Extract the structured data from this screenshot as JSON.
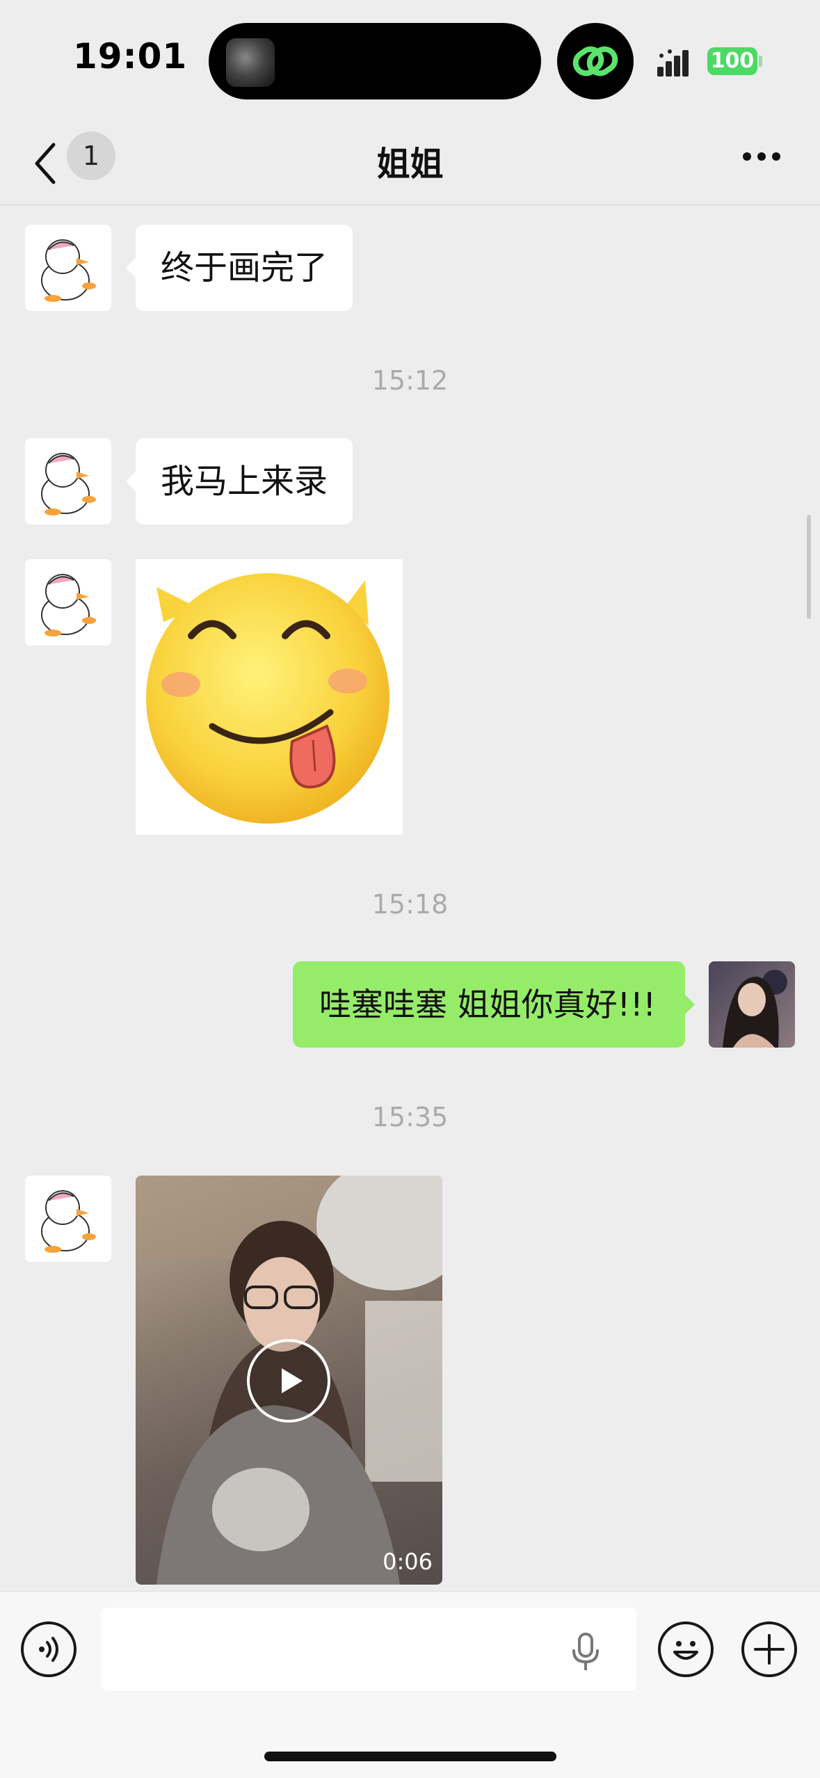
{
  "status_bar": {
    "time": "19:01",
    "battery": "100",
    "icons": [
      "album-art-icon",
      "link-icon",
      "signal-icon",
      "battery-icon"
    ]
  },
  "nav": {
    "back_icon": "chevron-left-icon",
    "unread_count": "1",
    "title": "姐姐",
    "more_icon": "ellipsis-icon"
  },
  "messages": [
    {
      "type": "text",
      "direction": "in",
      "text": "终于画完了"
    },
    {
      "type": "timestamp",
      "text": "15:12"
    },
    {
      "type": "text",
      "direction": "in",
      "text": "我马上来录"
    },
    {
      "type": "sticker",
      "direction": "in",
      "description": "smiley-tongue-sticker"
    },
    {
      "type": "timestamp",
      "text": "15:18"
    },
    {
      "type": "text",
      "direction": "out",
      "text": "哇塞哇塞 姐姐你真好!!!"
    },
    {
      "type": "timestamp",
      "text": "15:35"
    },
    {
      "type": "video",
      "direction": "in",
      "duration": "0:06"
    }
  ],
  "bottom_bar": {
    "voice_icon": "voice-icon",
    "input_placeholder": "",
    "mic_icon": "microphone-icon",
    "emoji_icon": "emoji-icon",
    "plus_icon": "plus-icon"
  },
  "colors": {
    "background": "#ededed",
    "outgoing_bubble": "#95ec69",
    "incoming_bubble": "#ffffff",
    "battery": "#4cd964"
  }
}
